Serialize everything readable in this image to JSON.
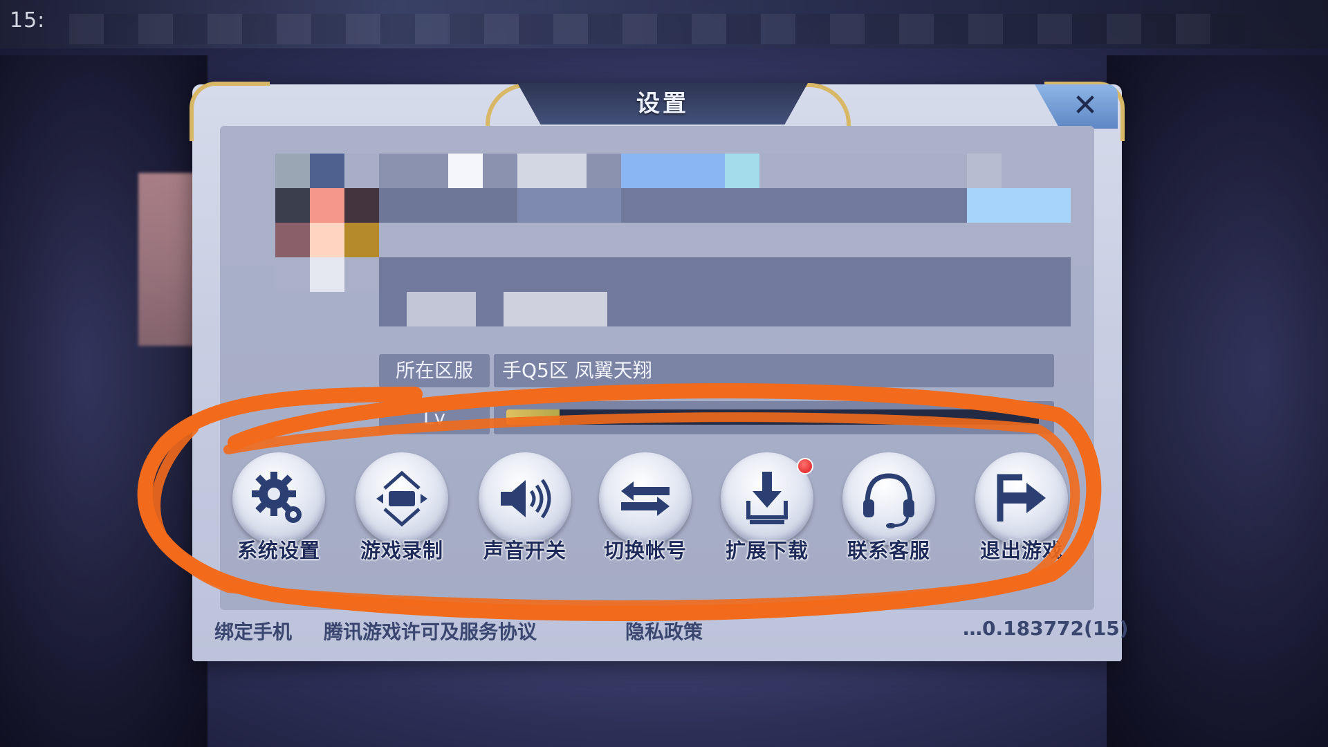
{
  "status_bar": {
    "time": "15:"
  },
  "dialog": {
    "title": "设置",
    "close_label": "✕",
    "server_label": "所在区服",
    "server_value": "手Q5区 凤翼天翔",
    "level_label": "Lv",
    "level_progress": 0.1
  },
  "buttons": [
    {
      "label": "系统设置",
      "icon": "gear-icon"
    },
    {
      "label": "游戏录制",
      "icon": "record-icon"
    },
    {
      "label": "声音开关",
      "icon": "speaker-icon"
    },
    {
      "label": "切换帐号",
      "icon": "switch-arrows-icon"
    },
    {
      "label": "扩展下载",
      "icon": "download-icon",
      "badge": true
    },
    {
      "label": "联系客服",
      "icon": "headset-icon"
    },
    {
      "label": "退出游戏",
      "icon": "exit-icon"
    }
  ],
  "footer": {
    "bind_phone": "绑定手机",
    "agreement": "腾讯游戏许可及服务协议",
    "privacy": "隐私政策",
    "version": "…0.183772(15)"
  },
  "colors": {
    "annotation": "#f26a1b",
    "gold": "#d8b866",
    "button_text": "#1d2a5a"
  }
}
